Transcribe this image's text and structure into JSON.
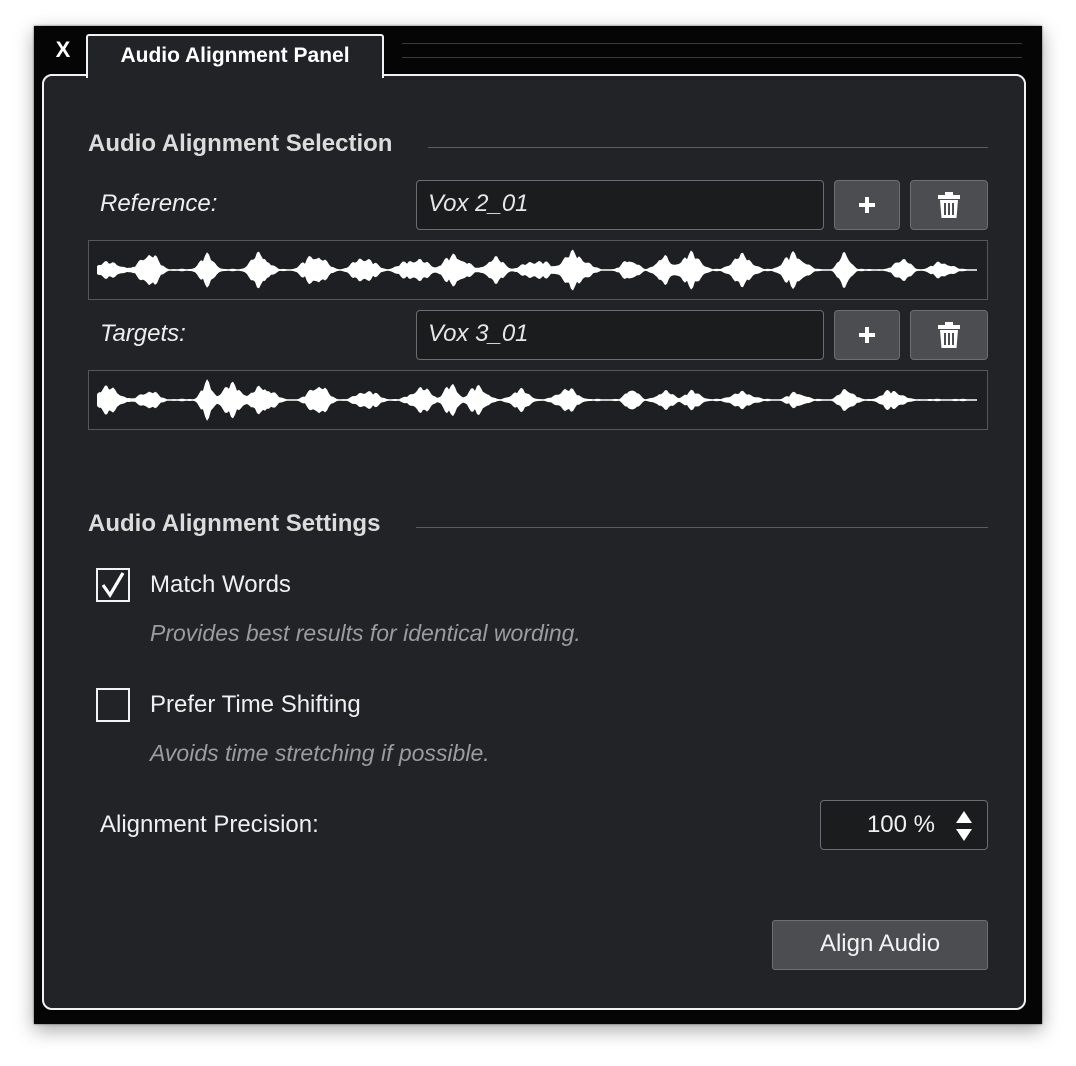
{
  "window": {
    "close_label": "X",
    "tab_title": "Audio Alignment Panel"
  },
  "selection": {
    "heading": "Audio Alignment Selection",
    "reference": {
      "label": "Reference:",
      "value": "Vox 2_01",
      "add_icon": "plus-icon",
      "delete_icon": "trash-icon"
    },
    "targets": {
      "label": "Targets:",
      "value": "Vox 3_01",
      "add_icon": "plus-icon",
      "delete_icon": "trash-icon"
    }
  },
  "settings": {
    "heading": "Audio Alignment Settings",
    "match_words": {
      "label": "Match Words",
      "checked": true,
      "description": "Provides best results for identical wording."
    },
    "prefer_time_shifting": {
      "label": "Prefer Time Shifting",
      "checked": false,
      "description": "Avoids time stretching if possible."
    },
    "precision": {
      "label": "Alignment Precision:",
      "value": "100 %"
    }
  },
  "actions": {
    "align_label": "Align Audio"
  },
  "colors": {
    "panel_bg": "#212326",
    "window_bg": "#050505",
    "button_bg": "#4b4d51",
    "waveform": "#ffffff"
  }
}
